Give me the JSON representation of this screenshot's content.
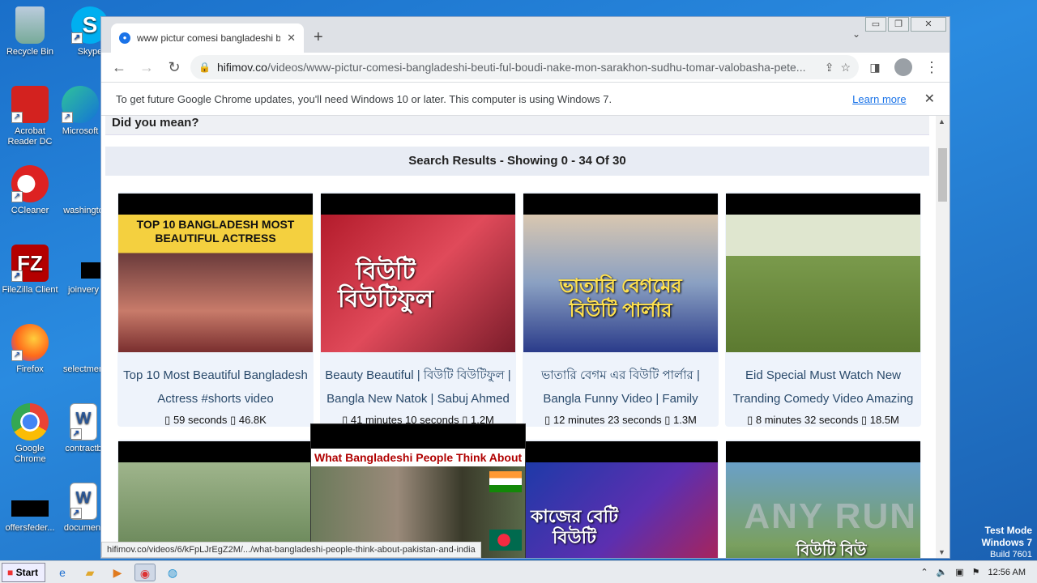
{
  "desktop": {
    "icons": [
      {
        "label": "Recycle Bin"
      },
      {
        "label": "Skype"
      },
      {
        "label": "Acrobat Reader DC"
      },
      {
        "label": "Microsoft"
      },
      {
        "label": "CCleaner"
      },
      {
        "label": "washingto"
      },
      {
        "label": "FileZilla Client"
      },
      {
        "label": "joinvery"
      },
      {
        "label": "Firefox"
      },
      {
        "label": "selectmen"
      },
      {
        "label": "Google Chrome"
      },
      {
        "label": "contractb"
      },
      {
        "label": "offersfeder..."
      },
      {
        "label": "document"
      }
    ]
  },
  "browser": {
    "tab_title": "www pictur comesi bangladeshi beut",
    "url_domain": "hifimov.co",
    "url_path": "/videos/www-pictur-comesi-bangladeshi-beuti-ful-boudi-nake-mon-sarakhon-sudhu-tomar-valobasha-pete...",
    "infobar_text": "To get future Google Chrome updates, you'll need Windows 10 or later. This computer is using Windows 7.",
    "infobar_link": "Learn more",
    "status_url": "hifimov.co/videos/6/kFpLJrEgZ2M/.../what-bangladeshi-people-think-about-pakistan-and-india"
  },
  "page": {
    "did_you_mean": "Did you mean?",
    "results_header": "Search Results - Showing 0 - 34 Of 30",
    "cards": [
      {
        "title": "Top 10 Most Beautiful Bangladesh Actress #shorts video",
        "duration": "59 seconds",
        "views": "46.8K",
        "thumb_text": "TOP 10 BANGLADESH MOST BEAUTIFUL ACTRESS"
      },
      {
        "title": "Beauty Beautiful | বিউটি বিউটিফুল | Bangla New Natok | Sabuj Ahmed",
        "duration": "41 minutes 10 seconds",
        "views": "1.2M",
        "thumb_text": "বিউটি বিউটিফুল"
      },
      {
        "title": "ভাতারি বেগম এর বিউটি পার্লার | Bangla Funny Video | Family",
        "duration": "12 minutes 23 seconds",
        "views": "1.3M",
        "thumb_text": "ভাতারি বেগমের বিউটি পার্লার"
      },
      {
        "title": "Eid Special Must Watch New Tranding Comedy Video Amazing",
        "duration": "8 minutes 32 seconds",
        "views": "18.5M",
        "thumb_text": ""
      }
    ],
    "popup_caption": "What Bangladeshi People Think About Pakistan and India",
    "row2_thumb_texts": [
      "",
      "",
      "কাজের বেটি বিউটি",
      "বিউটি বিউ"
    ]
  },
  "watermark": "ANY RUN",
  "testmode": {
    "line1": "Test Mode",
    "line2": "Windows 7",
    "line3": "Build 7601"
  },
  "taskbar": {
    "start_label": "Start",
    "clock": "12:56 AM"
  }
}
